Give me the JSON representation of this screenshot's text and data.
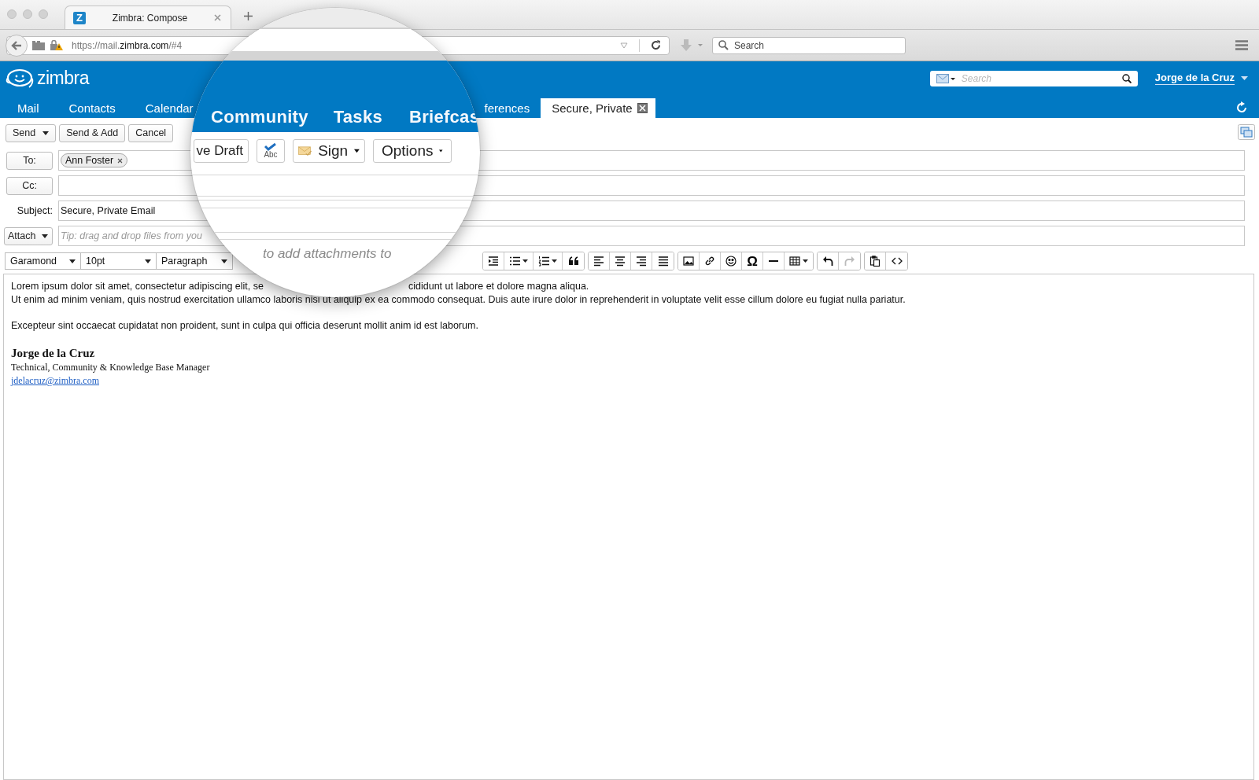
{
  "browser": {
    "tab": {
      "title": "Zimbra: Compose",
      "icon_letter": "Z"
    },
    "address": {
      "prefix": "https://mail.",
      "domain": "zimbra.com",
      "suffix": "/#4"
    },
    "search": {
      "placeholder": "Search"
    }
  },
  "header": {
    "logo": "zimbra",
    "search": {
      "placeholder": "Search"
    },
    "user": "Jorge de la Cruz"
  },
  "nav_tabs": [
    {
      "label": "Mail",
      "selected": false,
      "closable": false
    },
    {
      "label": "Contacts",
      "selected": false,
      "closable": false
    },
    {
      "label": "Calendar",
      "selected": false,
      "closable": false
    },
    {
      "label": "ferences",
      "selected": false,
      "closable": false
    },
    {
      "label": "Secure, Private",
      "selected": true,
      "closable": true
    }
  ],
  "toolbar": [
    {
      "label": "Send",
      "dropdown": true
    },
    {
      "label": "Send & Add",
      "dropdown": false
    },
    {
      "label": "Cancel",
      "dropdown": false
    }
  ],
  "fields": [
    {
      "kind": "recipients",
      "label": "To:",
      "chips": [
        "Ann Foster"
      ]
    },
    {
      "kind": "recipients",
      "label": "Cc:"
    },
    {
      "kind": "text",
      "label": "Subject:",
      "value": "Secure, Private Email"
    },
    {
      "kind": "attach",
      "label": "Attach",
      "placeholder": "Tip: drag and drop files from you"
    }
  ],
  "format": {
    "font": "Garamond",
    "size": "10pt",
    "block": "Paragraph",
    "groups": [
      [
        {
          "kind": "indent",
          "dropdown": false,
          "disabled": false
        },
        {
          "kind": "bullets",
          "dropdown": true,
          "disabled": false
        },
        {
          "kind": "numbers",
          "dropdown": true,
          "disabled": false
        },
        {
          "kind": "quote",
          "dropdown": false,
          "disabled": false
        }
      ],
      [
        {
          "kind": "align-left",
          "dropdown": false,
          "disabled": false
        },
        {
          "kind": "align-center",
          "dropdown": false,
          "disabled": false
        },
        {
          "kind": "align-right",
          "dropdown": false,
          "disabled": false
        },
        {
          "kind": "justify",
          "dropdown": false,
          "disabled": false
        }
      ],
      [
        {
          "kind": "image",
          "dropdown": false,
          "disabled": false
        },
        {
          "kind": "link",
          "dropdown": false,
          "disabled": false
        },
        {
          "kind": "emoji",
          "dropdown": false,
          "disabled": false
        },
        {
          "kind": "symbol",
          "label": "Ω",
          "dropdown": false,
          "disabled": false
        },
        {
          "kind": "rule",
          "dropdown": false,
          "disabled": false
        },
        {
          "kind": "table",
          "dropdown": true,
          "disabled": false
        }
      ],
      [
        {
          "kind": "undo",
          "dropdown": false,
          "disabled": false
        },
        {
          "kind": "redo",
          "dropdown": false,
          "disabled": true
        }
      ],
      [
        {
          "kind": "paste",
          "dropdown": false,
          "disabled": false
        },
        {
          "kind": "code",
          "dropdown": false,
          "disabled": false
        }
      ]
    ]
  },
  "body": {
    "first_line": [
      "Lorem ipsum dolor sit amet, consectetur adipiscing elit, se",
      "cididunt ut labore et dolore magna aliqua."
    ],
    "lines": [
      "Ut enim ad minim veniam, quis nostrud exercitation ullamco laboris nisi ut aliquip ex ea commodo consequat. Duis aute irure dolor in reprehenderit in voluptate velit esse cillum dolore eu fugiat nulla pariatur.",
      "Excepteur sint occaecat cupidatat non proident, sunt in culpa qui officia deserunt mollit anim id est laborum."
    ]
  },
  "signature": {
    "name": "Jorge de la Cruz",
    "title": "Technical, Community & Knowledge Base Manager",
    "email": "jdelacruz@zimbra.com"
  },
  "magnifier": {
    "tabs": [
      "Community",
      "Tasks",
      "Briefcas"
    ],
    "buttons": [
      {
        "kind": "text",
        "label": "ve Draft"
      },
      {
        "kind": "spellcheck",
        "label": "Abc"
      },
      {
        "kind": "sign",
        "label": "Sign"
      },
      {
        "kind": "menu",
        "label": "Options"
      }
    ],
    "hint": "to add attachments to"
  }
}
